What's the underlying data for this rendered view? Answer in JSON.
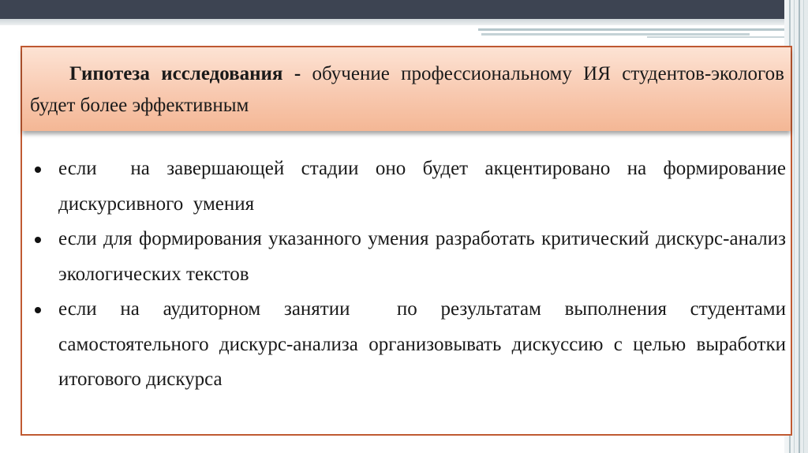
{
  "hypothesis": {
    "lead": "Гипотеза исследования -",
    "rest": " обучение профессиональному ИЯ студентов-экологов будет более эффективным"
  },
  "conditions": [
    "если  на завершающей стадии оно будет акцентировано на формирование дискурсивного  умения",
    "если для формирования указанного умения разработать критический дискурс-анализ экологических текстов",
    "если на аудиторном занятии  по результатам выполнения студентами самостоятельного дискурс-анализа организовывать дискуссию с целью выработки итогового дискурса"
  ],
  "colors": {
    "frame_border": "#c05a32",
    "header_fill": "#f8c9b0",
    "top_bar": "#3d4452"
  }
}
